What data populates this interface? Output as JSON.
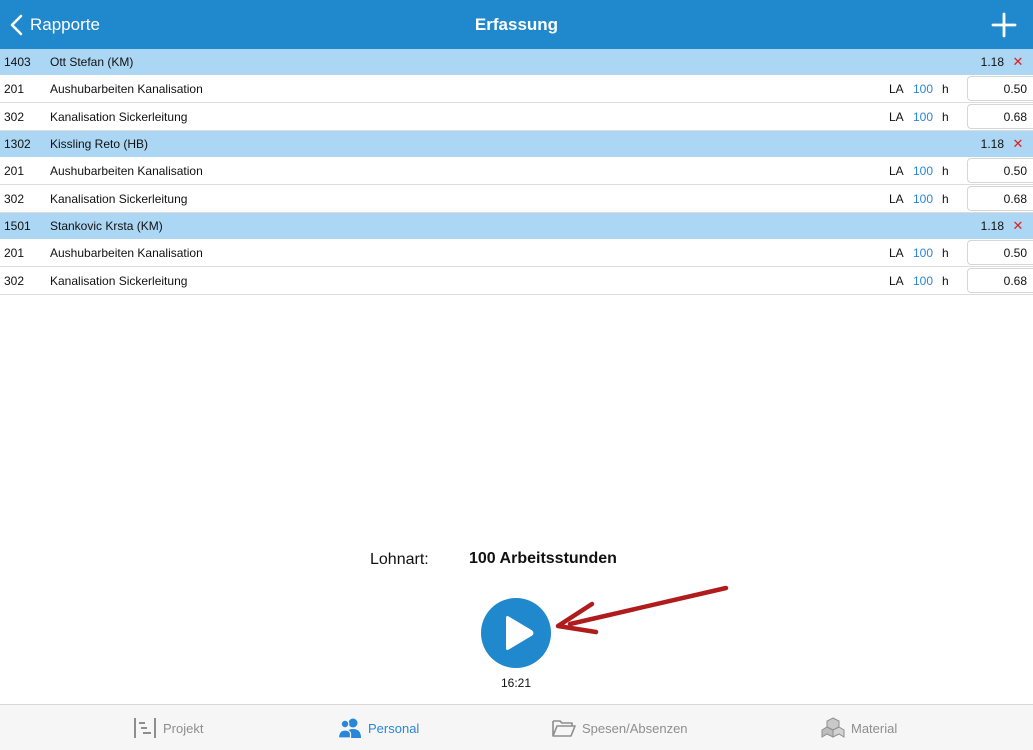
{
  "header": {
    "back_label": "Rapporte",
    "title": "Erfassung"
  },
  "groups": [
    {
      "code": "1403",
      "name": "Ott Stefan (KM)",
      "total": "1.18",
      "items": [
        {
          "code": "201",
          "name": "Aushubarbeiten Kanalisation",
          "la": "LA",
          "la_num": "100",
          "unit": "h",
          "hours": "0.50"
        },
        {
          "code": "302",
          "name": "Kanalisation Sickerleitung",
          "la": "LA",
          "la_num": "100",
          "unit": "h",
          "hours": "0.68"
        }
      ]
    },
    {
      "code": "1302",
      "name": "Kissling Reto (HB)",
      "total": "1.18",
      "items": [
        {
          "code": "201",
          "name": "Aushubarbeiten Kanalisation",
          "la": "LA",
          "la_num": "100",
          "unit": "h",
          "hours": "0.50"
        },
        {
          "code": "302",
          "name": "Kanalisation Sickerleitung",
          "la": "LA",
          "la_num": "100",
          "unit": "h",
          "hours": "0.68"
        }
      ]
    },
    {
      "code": "1501",
      "name": "Stankovic Krsta (KM)",
      "total": "1.18",
      "items": [
        {
          "code": "201",
          "name": "Aushubarbeiten Kanalisation",
          "la": "LA",
          "la_num": "100",
          "unit": "h",
          "hours": "0.50"
        },
        {
          "code": "302",
          "name": "Kanalisation Sickerleitung",
          "la": "LA",
          "la_num": "100",
          "unit": "h",
          "hours": "0.68"
        }
      ]
    }
  ],
  "lohnart": {
    "label": "Lohnart:",
    "value": "100 Arbeitsstunden"
  },
  "timer": {
    "time": "16:21"
  },
  "tabs": [
    {
      "label": "Projekt",
      "icon": "project-icon",
      "active": false
    },
    {
      "label": "Personal",
      "icon": "people-icon",
      "active": true
    },
    {
      "label": "Spesen/Absenzen",
      "icon": "folder-icon",
      "active": false
    },
    {
      "label": "Material",
      "icon": "material-icon",
      "active": false
    }
  ],
  "colors": {
    "header_blue": "#2088cc",
    "group_row_blue": "#abd6f4",
    "link_blue": "#2a86d8",
    "delete_red": "#e21d1d",
    "annotation_arrow": "#b01c1c"
  }
}
